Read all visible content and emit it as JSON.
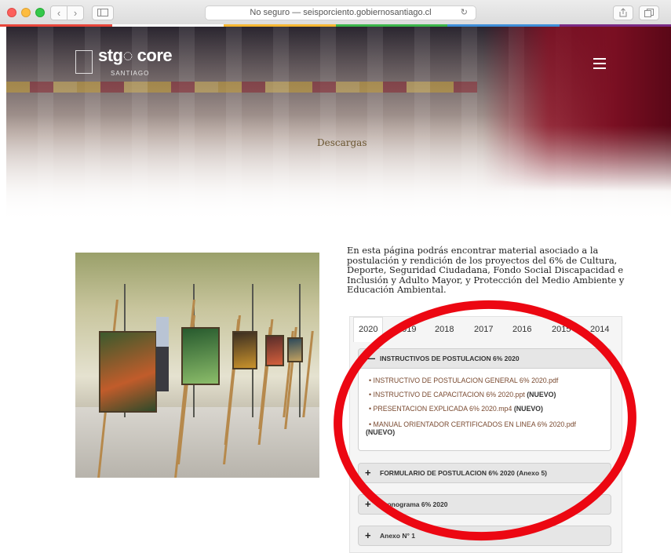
{
  "browser": {
    "address_security": "No seguro",
    "address_separator": " — ",
    "address_host": "seisporciento.gobiernosantiago.cl",
    "nav_back": "‹",
    "nav_forward": "›",
    "icons": [
      "close-traffic-light",
      "minimize-traffic-light",
      "zoom-traffic-light",
      "back-icon",
      "forward-icon",
      "sidebar-icon",
      "reload-icon",
      "share-icon",
      "tabs-icon"
    ],
    "strip_colors": [
      "#e8463b",
      "#ffffff",
      "#f7b731",
      "#3bb54a",
      "#3d8ed8",
      "#7a2a85"
    ]
  },
  "header": {
    "logo_text": "stg◌ core",
    "logo_sub": "SANTIAGO",
    "page_title": "Descargas"
  },
  "intro": {
    "text": "En esta página podrás encontrar material asociado a la postulación y rendición de los proyectos del 6% de Cultura, Deporte, Seguridad Ciudadana, Fondo Social Discapacidad e Inclusión y Adulto Mayor, y Protección del Medio Ambiente y Educación Ambiental."
  },
  "year_tabs": {
    "active": "2020",
    "items": [
      "2020",
      "2019",
      "2018",
      "2017",
      "2016",
      "2015",
      "2014"
    ]
  },
  "accordion": {
    "open": {
      "sign": "—",
      "title": "INSTRUCTIVOS DE POSTULACION 6% 2020",
      "items": [
        {
          "text": "• INSTRUCTIVO DE POSTULACION GENERAL 6% 2020.pdf",
          "badge": ""
        },
        {
          "text": "• INSTRUCTIVO DE CAPACITACION 6% 2020.ppt",
          "badge": "(NUEVO)"
        },
        {
          "text": "• PRESENTACION EXPLICADA 6% 2020.mp4",
          "badge": "(NUEVO)"
        },
        {
          "text": "• MANUAL ORIENTADOR CERTIFICADOS EN LINEA 6% 2020.pdf",
          "badge": "(NUEVO)"
        }
      ]
    },
    "closed": [
      {
        "sign": "+",
        "title": "FORMULARIO DE POSTULACION 6% 2020 (Anexo 5)"
      },
      {
        "sign": "+",
        "title": "Cronograma 6% 2020"
      },
      {
        "sign": "+",
        "title": "Anexo N° 1"
      }
    ]
  },
  "annotation": {
    "color": "#ec0712",
    "shape": "ellipse"
  }
}
